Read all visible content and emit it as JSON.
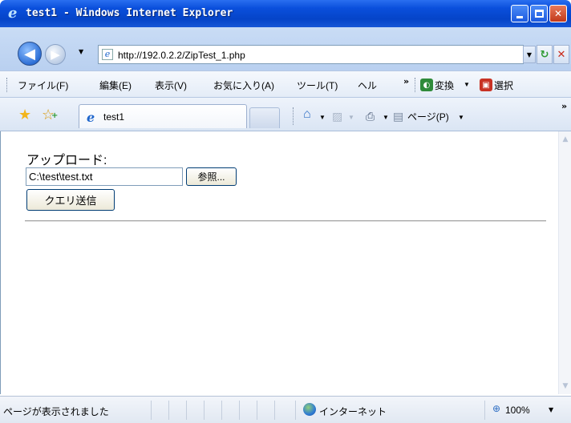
{
  "window": {
    "title": "test1 - Windows Internet Explorer"
  },
  "address": {
    "url": "http://192.0.2.2/ZipTest_1.php"
  },
  "menu": {
    "items": [
      "ファイル(F)",
      "編集(E)",
      "表示(V)",
      "お気に入り(A)",
      "ツール(T)",
      "ヘル"
    ],
    "overflow": "»",
    "convert_label": "変換",
    "select_label": "選択"
  },
  "tabs": {
    "active_label": "test1"
  },
  "commands": {
    "page_label": "ページ(P)",
    "overflow": "»"
  },
  "form": {
    "upload_label": "アップロード:",
    "file_value": "C:\\test\\test.txt",
    "browse_label": "参照...",
    "submit_label": "クエリ送信"
  },
  "status": {
    "message": "ページが表示されました",
    "zone": "インターネット",
    "zoom": "100%"
  },
  "colors": {
    "title_bar": "#0a4fdc",
    "chrome": "#dae5f4"
  }
}
